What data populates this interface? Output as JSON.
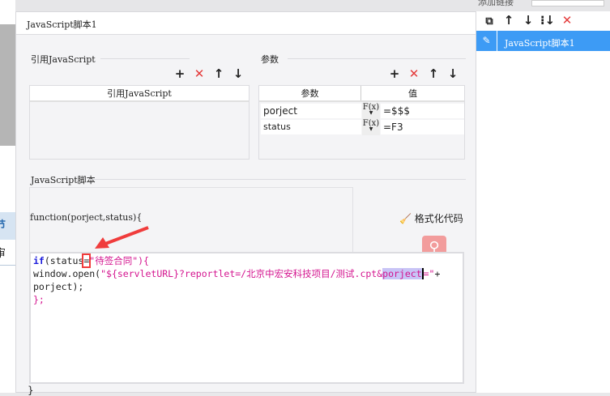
{
  "background": {
    "top_right_tab": "添加链接",
    "left_labels": [
      "节点",
      "审核"
    ]
  },
  "dialog": {
    "title": "JavaScript脚本1",
    "ref_section": {
      "title": "引用JavaScript",
      "column": "引用JavaScript",
      "toolbar": [
        "plus-icon",
        "delete-icon",
        "arrow-up-icon",
        "arrow-down-icon"
      ]
    },
    "params_section": {
      "title": "参数",
      "columns": [
        "参数",
        "值"
      ],
      "rows": [
        {
          "name": "porject",
          "value": "=$$$"
        },
        {
          "name": "status",
          "value": "=F3"
        }
      ],
      "fx_label": "F(x)"
    },
    "script_section": {
      "title": "JavaScript脚本",
      "signature": "function(porject,status){",
      "format_button": "格式化代码",
      "closing": "}",
      "code": {
        "l1_kw": "if",
        "l1_a": "(status",
        "l1_eq": "=",
        "l1_str": "\"待签合同\"",
        "l1_b": "){",
        "l2_a": "window.open(",
        "l2_str": "\"${servletURL}?reportlet=/北京中宏安科技项目/测试.cpt&",
        "l2_sel": "porject",
        "l2_str2": "=\"",
        "l2_b": "+",
        "l3": "porject);",
        "l4": "};"
      }
    }
  },
  "right_panel": {
    "items": [
      {
        "label": "JavaScript脚本1",
        "selected": true
      }
    ],
    "accent": "#3d9bf5"
  },
  "colors": {
    "annotation": "#f03c3c",
    "keyword": "#1a1adb",
    "string": "#d4148f"
  }
}
